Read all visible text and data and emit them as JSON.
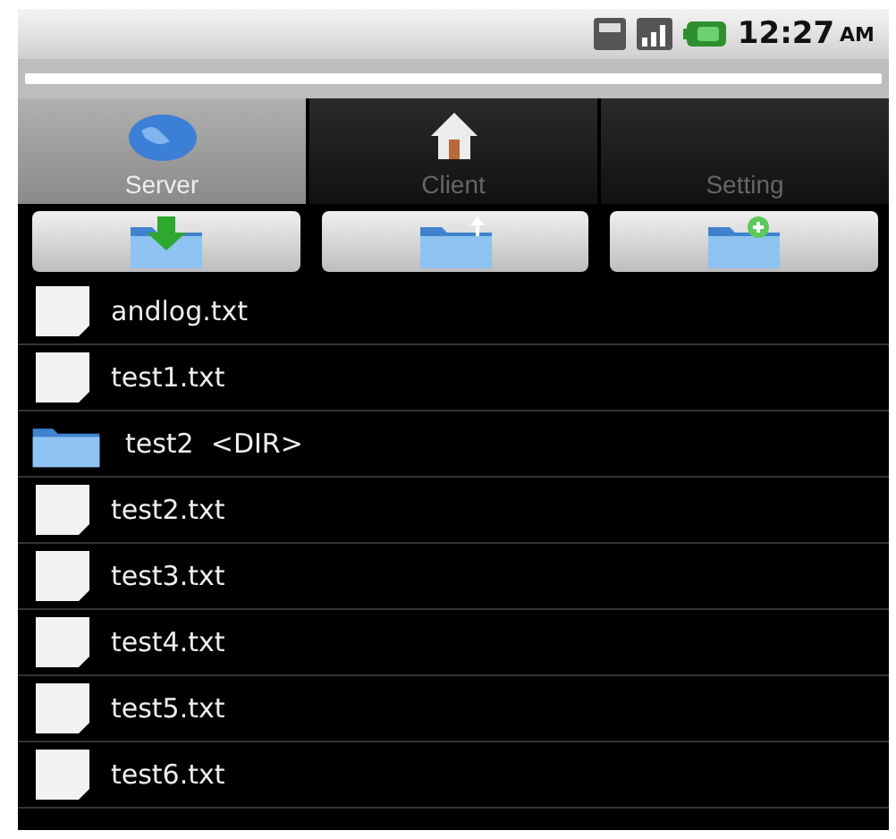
{
  "status_bar": {
    "time": "12:27",
    "meridiem": "AM"
  },
  "tabs": [
    {
      "label": "Server",
      "kind": "globe",
      "selected": true
    },
    {
      "label": "Client",
      "kind": "house",
      "selected": false
    },
    {
      "label": "Setting",
      "kind": "plain",
      "selected": false
    }
  ],
  "toolbar": [
    {
      "kind": "download"
    },
    {
      "kind": "up"
    },
    {
      "kind": "new"
    }
  ],
  "files": [
    {
      "name": "andlog.txt",
      "kind": "file"
    },
    {
      "name": "test1.txt",
      "kind": "file"
    },
    {
      "name": "test2  <DIR>",
      "kind": "dir"
    },
    {
      "name": "test2.txt",
      "kind": "file"
    },
    {
      "name": "test3.txt",
      "kind": "file"
    },
    {
      "name": "test4.txt",
      "kind": "file"
    },
    {
      "name": "test5.txt",
      "kind": "file"
    },
    {
      "name": "test6.txt",
      "kind": "file"
    }
  ]
}
